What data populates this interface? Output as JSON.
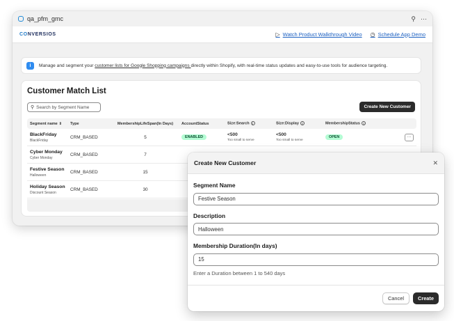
{
  "window": {
    "title": "qa_pfm_gmc",
    "pin_icon": "pin-icon",
    "more_icon": "more-icon"
  },
  "nav": {
    "logo_prefix": "CO",
    "logo_rest": "NVERSIOS",
    "watch_video": "Watch Product Walkthrough Video",
    "schedule_demo": "Schedule App Demo"
  },
  "banner": {
    "text_before": "Manage and segment your ",
    "link": "customer lists for Google Shopping campaigns ",
    "text_after": "directly within Shopify, with real-time status updates and easy-to-use tools for audience targeting."
  },
  "list": {
    "title": "Customer Match List",
    "search_placeholder": "Search by Segment Name",
    "create_button": "Create New Customer",
    "headers": {
      "segment": "Segment name",
      "type": "Type",
      "lifespan": "MembershipLifeSpan(In Days)",
      "account_status": "AccountStatus",
      "size_search": "Size:Search",
      "size_display": "Size:Display",
      "membership_status": "MembershipStatus"
    },
    "rows": [
      {
        "name": "BlackFriday",
        "desc": "BlackFriday",
        "type": "CRM_BASED",
        "lifespan": "5",
        "account_status": "ENABLED",
        "size_search": "<500",
        "size_search_sub": "Too small to serve",
        "size_display": "<500",
        "size_display_sub": "Too small to serve",
        "membership_status": "OPEN",
        "more": "···"
      },
      {
        "name": "Cyber Monday",
        "desc": "Cyber Monday",
        "type": "CRM_BASED",
        "lifespan": "7"
      },
      {
        "name": "Festive Season",
        "desc": "Halloween",
        "type": "CRM_BASED",
        "lifespan": "15"
      },
      {
        "name": "Holiday Season",
        "desc": "Discount Season",
        "type": "CRM_BASED",
        "lifespan": "30"
      }
    ]
  },
  "modal": {
    "title": "Create New Customer",
    "segment_label": "Segment Name",
    "segment_value": "Festive Season",
    "description_label": "Description",
    "description_value": "Halloween",
    "duration_label": "Membership Duration(In days)",
    "duration_value": "15",
    "helper": "Enter a Duration between 1 to 540 days",
    "cancel": "Cancel",
    "create": "Create"
  },
  "colors": {
    "accent": "#2f8cf0",
    "link": "#1a5fc1",
    "badge_bg": "#b4fcd4",
    "badge_text": "#0c5132",
    "primary_btn": "#2b2b2b"
  }
}
